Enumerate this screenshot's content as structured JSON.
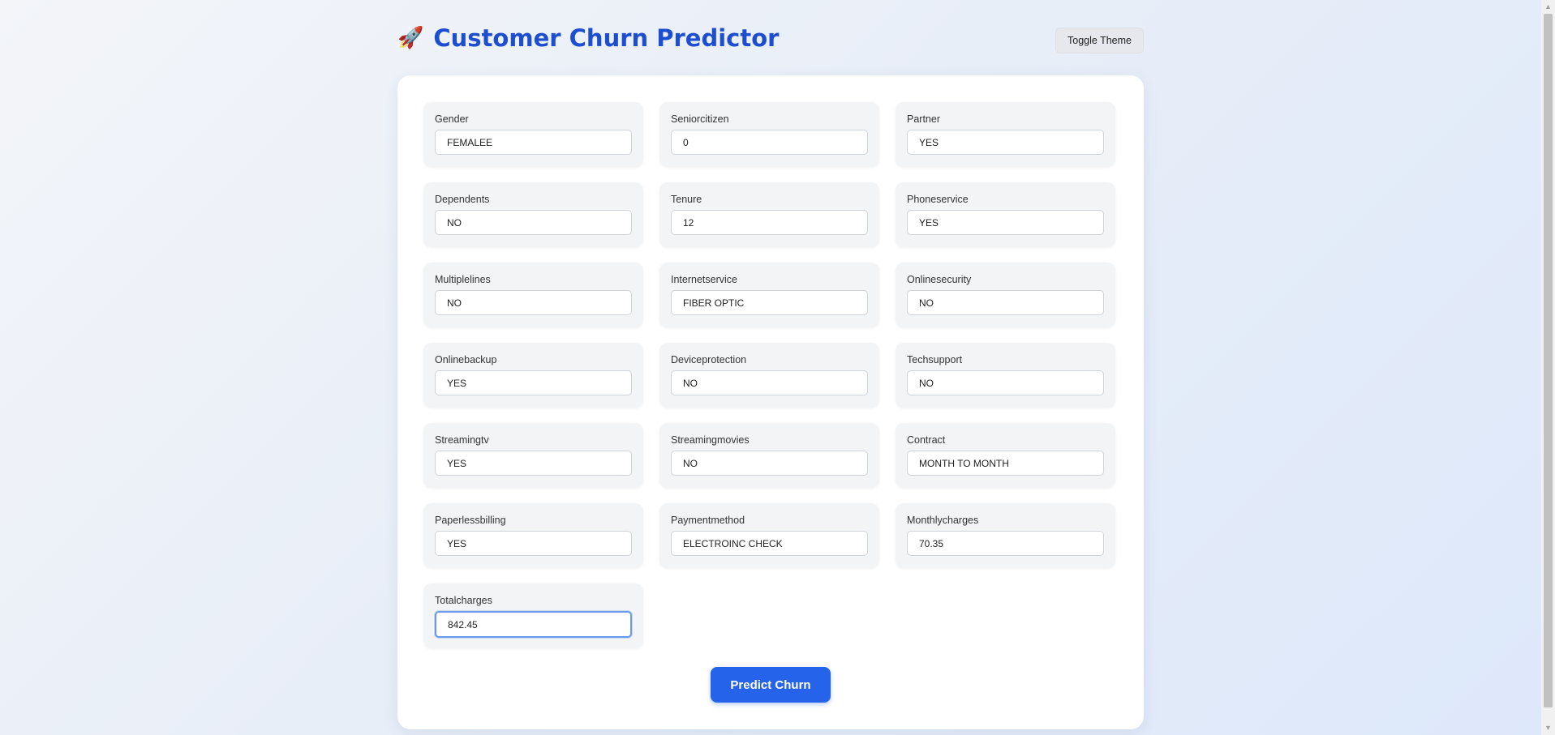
{
  "header": {
    "icon": "rocket-icon",
    "title": "Customer Churn Predictor",
    "theme_button": "Toggle Theme"
  },
  "fields": [
    {
      "label": "Gender",
      "value": "FEMALEE"
    },
    {
      "label": "Seniorcitizen",
      "value": "0"
    },
    {
      "label": "Partner",
      "value": "YES"
    },
    {
      "label": "Dependents",
      "value": "NO"
    },
    {
      "label": "Tenure",
      "value": "12"
    },
    {
      "label": "Phoneservice",
      "value": "YES"
    },
    {
      "label": "Multiplelines",
      "value": "NO"
    },
    {
      "label": "Internetservice",
      "value": "FIBER OPTIC"
    },
    {
      "label": "Onlinesecurity",
      "value": "NO"
    },
    {
      "label": "Onlinebackup",
      "value": "YES"
    },
    {
      "label": "Deviceprotection",
      "value": "NO"
    },
    {
      "label": "Techsupport",
      "value": "NO"
    },
    {
      "label": "Streamingtv",
      "value": "YES"
    },
    {
      "label": "Streamingmovies",
      "value": "NO"
    },
    {
      "label": "Contract",
      "value": "MONTH TO MONTH"
    },
    {
      "label": "Paperlessbilling",
      "value": "YES"
    },
    {
      "label": "Paymentmethod",
      "value": "ELECTROINC CHECK"
    },
    {
      "label": "Monthlycharges",
      "value": "70.35"
    },
    {
      "label": "Totalcharges",
      "value": "842.45"
    }
  ],
  "predict_button": "Predict Churn",
  "colors": {
    "title": "#1e4ed0",
    "primary_button": "#2563eb",
    "focus_ring": "#6b9ae8"
  }
}
